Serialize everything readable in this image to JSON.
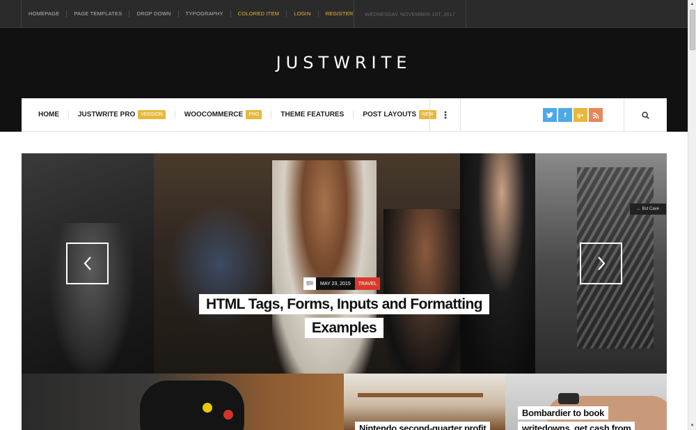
{
  "topbar": {
    "links": [
      {
        "label": "HOMEPAGE"
      },
      {
        "label": "PAGE TEMPLATES"
      },
      {
        "label": "DROP DOWN"
      },
      {
        "label": "TYPOGRAPHY"
      },
      {
        "label": "COLORED ITEM"
      },
      {
        "label": "LOGIN"
      },
      {
        "label": "REGISTER"
      }
    ],
    "date": "WEDNESDAY, NOVEMBER 1ST, 2017"
  },
  "header": {
    "logo": "JUSTWRITE"
  },
  "nav": {
    "items": [
      {
        "label": "HOME"
      },
      {
        "label": "JUSTWRITE PRO",
        "badge": "VERSION"
      },
      {
        "label": "WOOCOMMERCE",
        "badge": "PRO"
      },
      {
        "label": "THEME FEATURES"
      },
      {
        "label": "POST LAYOUTS",
        "badge": "NEW"
      }
    ],
    "more_icon": "vertical-ellipsis-icon",
    "social": [
      {
        "name": "twitter-icon",
        "glyph": "t",
        "color": "#4ea9e6"
      },
      {
        "name": "facebook-icon",
        "glyph": "f",
        "color": "#4ea9e6"
      },
      {
        "name": "google-plus-icon",
        "glyph": "g+",
        "color": "#e8b83c"
      },
      {
        "name": "rss-icon",
        "glyph": "◝",
        "color": "#e8875a"
      }
    ],
    "search_icon": "search-icon"
  },
  "slider": {
    "date": "MAY 23, 2015",
    "category": "TRAVEL",
    "title": "HTML Tags, Forms, Inputs and Formatting Examples",
    "title_lines": [
      "HTML Tags, Forms, Inputs and Formatting",
      "Examples"
    ],
    "sign_text": "← Bst Cave",
    "prev_icon": "chevron-left-icon",
    "next_icon": "chevron-right-icon"
  },
  "cards": [
    {
      "title": ""
    },
    {
      "title": "Nintendo second-quarter profit"
    },
    {
      "title_lines": [
        "Bombardier to book",
        "writedowns, get cash from"
      ]
    }
  ],
  "colors": {
    "accent": "#e8b83c",
    "category_red": "#d63a2f",
    "header_bg": "#111111",
    "topbar_bg": "#2b2b2b"
  }
}
